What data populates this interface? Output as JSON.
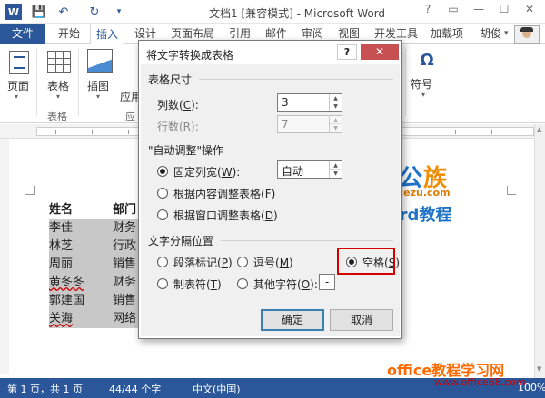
{
  "window": {
    "title": "文档1 [兼容模式] - Microsoft Word",
    "logo_text": "W"
  },
  "qat": {
    "save": "💾",
    "undo": "↶",
    "redo": "↻",
    "more": "▾"
  },
  "window_controls": {
    "help": "?",
    "restore_ribbon": "▭",
    "minimize": "—",
    "maximize": "☐",
    "close": "✕"
  },
  "tabs": [
    "开始",
    "插入",
    "设计",
    "页面布局",
    "引用",
    "邮件",
    "审阅",
    "视图",
    "开发工具",
    "加载项"
  ],
  "file_tab": "文件",
  "active_tab": "插入",
  "user": {
    "name": "胡俊",
    "caret": "▾"
  },
  "ribbon": {
    "pages_label": "页面",
    "table_label": "表格",
    "picture_label": "插图",
    "app_label_partial": "应用",
    "group_table": "表格",
    "group_app_partial": "应",
    "symbol_glyph": "Ω",
    "symbol_label": "符号"
  },
  "document": {
    "header": [
      "姓名",
      "部门"
    ],
    "rows": [
      [
        "李佳",
        "财务"
      ],
      [
        "林芝",
        "行政"
      ],
      [
        "周丽",
        "销售"
      ],
      [
        "黄冬冬",
        "财务"
      ],
      [
        "郭建国",
        "销售"
      ],
      [
        "关海",
        "网络"
      ]
    ]
  },
  "logos": {
    "brand_main": "办公",
    "brand_accent": "族",
    "brand_url": "Officezu.com",
    "brand_tagline": "Word教程",
    "watermark": "office教程学习网",
    "watermark_url": "www.office68.com"
  },
  "status": {
    "page": "第 1 页，共 1 页",
    "words": "44/44 个字",
    "language": "中文(中国)",
    "zoom": "100%"
  },
  "dialog": {
    "title": "将文字转换成表格",
    "help": "?",
    "close": "✕",
    "table_size_label": "表格尺寸",
    "columns_label": "列数(",
    "columns_key": "C",
    "columns_value": "3",
    "rows_label": "行数(R):",
    "rows_value": "7",
    "autofit_label": "\"自动调整\"操作",
    "fixed_width_label": "固定列宽(",
    "fixed_width_key": "W",
    "fixed_width_value": "自动",
    "fit_content_label": "根据内容调整表格(",
    "fit_content_key": "F",
    "fit_window_label": "根据窗口调整表格(",
    "fit_window_key": "D",
    "separator_label": "文字分隔位置",
    "paragraph_label": "段落标记(",
    "paragraph_key": "P",
    "comma_label": "逗号(",
    "comma_key": "M",
    "space_label": "空格(",
    "space_key": "S",
    "tab_label": "制表符(",
    "tab_key": "T",
    "other_label": "其他字符(",
    "other_key": "O",
    "other_value": "-",
    "ok_label": "确定",
    "cancel_label": "取消",
    "selected_fit": "fixed",
    "selected_separator": "space"
  },
  "colors": {
    "accent": "#2b579a",
    "highlight": "#d40000",
    "logo_blue": "#1f73c8",
    "logo_orange": "#f08c00"
  }
}
